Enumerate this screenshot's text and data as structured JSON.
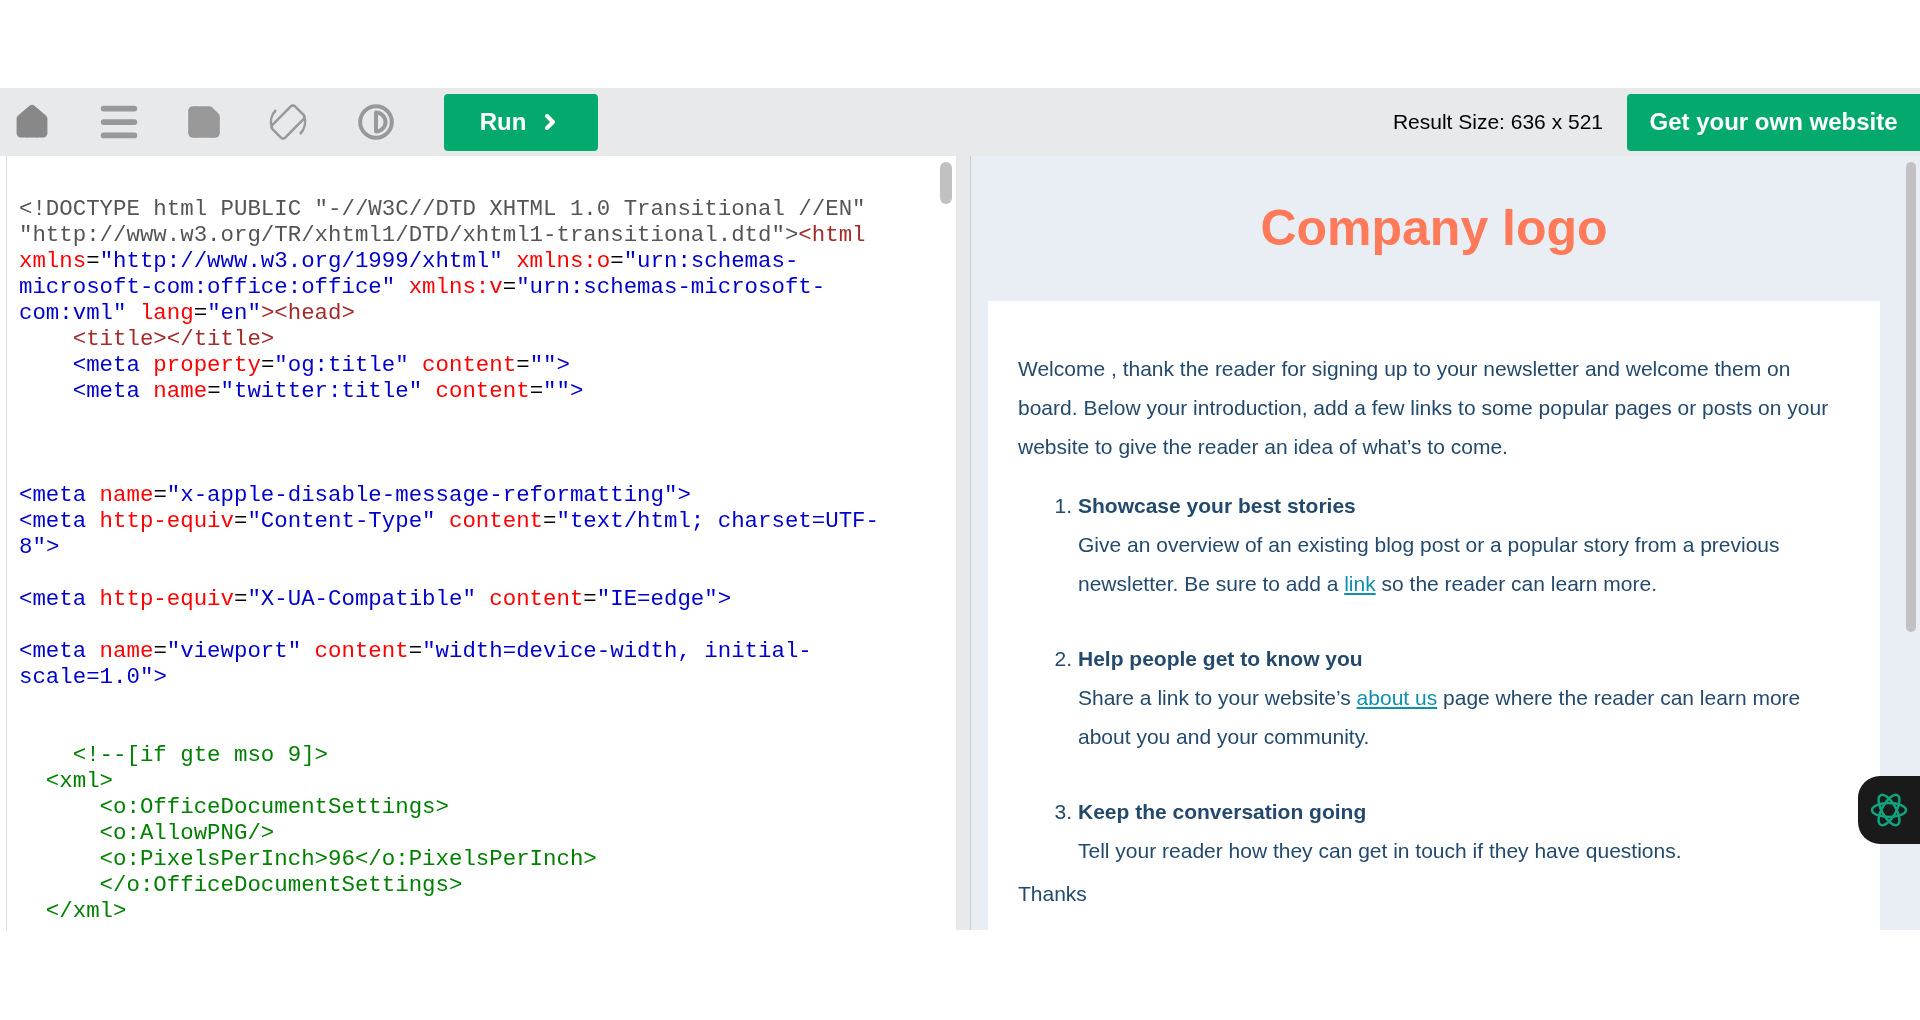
{
  "toolbar": {
    "run_button": "Run",
    "result_size": "Result Size: 636 x 521",
    "cta_button": "Get your own website"
  },
  "code": [
    {
      "kind": "code",
      "tokens": [
        {
          "kind": "doctype",
          "text": "<!DOCTYPE html PUBLIC \"-//W3C//DTD XHTML 1.0 Transitional //EN\""
        }
      ]
    },
    {
      "kind": "code",
      "tokens": [
        {
          "kind": "doctype",
          "text": "\"http://www.w3.org/TR/xhtml1/DTD/xhtml1-transitional.dtd\">"
        },
        {
          "kind": "tag",
          "text": "<html"
        }
      ]
    },
    {
      "kind": "code",
      "tokens": [
        {
          "kind": "attr",
          "text": "xmlns"
        },
        {
          "kind": "punct",
          "text": "="
        },
        {
          "kind": "value",
          "text": "\"http://www.w3.org/1999/xhtml\""
        },
        {
          "kind": "attr",
          "text": " xmlns:o"
        },
        {
          "kind": "punct",
          "text": "="
        },
        {
          "kind": "value",
          "text": "\"urn:schemas-"
        }
      ]
    },
    {
      "kind": "code",
      "tokens": [
        {
          "kind": "value",
          "text": "microsoft-com:office:office\""
        },
        {
          "kind": "attr",
          "text": " xmlns:v"
        },
        {
          "kind": "punct",
          "text": "="
        },
        {
          "kind": "value",
          "text": "\"urn:schemas-microsoft-"
        }
      ]
    },
    {
      "kind": "code",
      "tokens": [
        {
          "kind": "value",
          "text": "com:vml\""
        },
        {
          "kind": "attr",
          "text": " lang"
        },
        {
          "kind": "punct",
          "text": "="
        },
        {
          "kind": "value",
          "text": "\"en\""
        },
        {
          "kind": "tag",
          "text": "><head>"
        }
      ]
    },
    {
      "kind": "code",
      "tokens": [
        {
          "kind": "tag",
          "text": "    <title></title>"
        }
      ]
    },
    {
      "kind": "code",
      "tokens": [
        {
          "kind": "element",
          "text": "    <meta"
        },
        {
          "kind": "attr",
          "text": " property"
        },
        {
          "kind": "punct",
          "text": "="
        },
        {
          "kind": "value",
          "text": "\"og:title\""
        },
        {
          "kind": "attr",
          "text": " content"
        },
        {
          "kind": "punct",
          "text": "="
        },
        {
          "kind": "value",
          "text": "\"\""
        },
        {
          "kind": "element",
          "text": ">"
        }
      ]
    },
    {
      "kind": "code",
      "tokens": [
        {
          "kind": "element",
          "text": "    <meta"
        },
        {
          "kind": "attr",
          "text": " name"
        },
        {
          "kind": "punct",
          "text": "="
        },
        {
          "kind": "value",
          "text": "\"twitter:title\""
        },
        {
          "kind": "attr",
          "text": " content"
        },
        {
          "kind": "punct",
          "text": "="
        },
        {
          "kind": "value",
          "text": "\"\""
        },
        {
          "kind": "element",
          "text": ">"
        }
      ]
    },
    {
      "kind": "blank"
    },
    {
      "kind": "blank"
    },
    {
      "kind": "blank"
    },
    {
      "kind": "code",
      "tokens": [
        {
          "kind": "element",
          "text": "<meta"
        },
        {
          "kind": "attr",
          "text": " name"
        },
        {
          "kind": "punct",
          "text": "="
        },
        {
          "kind": "value",
          "text": "\"x-apple-disable-message-reformatting\""
        },
        {
          "kind": "element",
          "text": ">"
        }
      ]
    },
    {
      "kind": "code",
      "tokens": [
        {
          "kind": "element",
          "text": "<meta"
        },
        {
          "kind": "attr",
          "text": " http-equiv"
        },
        {
          "kind": "punct",
          "text": "="
        },
        {
          "kind": "value",
          "text": "\"Content-Type\""
        },
        {
          "kind": "attr",
          "text": " content"
        },
        {
          "kind": "punct",
          "text": "="
        },
        {
          "kind": "value",
          "text": "\"text/html; charset=UTF-"
        }
      ]
    },
    {
      "kind": "code",
      "tokens": [
        {
          "kind": "value",
          "text": "8\""
        },
        {
          "kind": "element",
          "text": ">"
        }
      ]
    },
    {
      "kind": "blank"
    },
    {
      "kind": "code",
      "tokens": [
        {
          "kind": "element",
          "text": "<meta"
        },
        {
          "kind": "attr",
          "text": " http-equiv"
        },
        {
          "kind": "punct",
          "text": "="
        },
        {
          "kind": "value",
          "text": "\"X-UA-Compatible\""
        },
        {
          "kind": "attr",
          "text": " content"
        },
        {
          "kind": "punct",
          "text": "="
        },
        {
          "kind": "value",
          "text": "\"IE=edge\""
        },
        {
          "kind": "element",
          "text": ">"
        }
      ]
    },
    {
      "kind": "blank"
    },
    {
      "kind": "code",
      "tokens": [
        {
          "kind": "element",
          "text": "<meta"
        },
        {
          "kind": "attr",
          "text": " name"
        },
        {
          "kind": "punct",
          "text": "="
        },
        {
          "kind": "value",
          "text": "\"viewport\""
        },
        {
          "kind": "attr",
          "text": " content"
        },
        {
          "kind": "punct",
          "text": "="
        },
        {
          "kind": "value",
          "text": "\"width=device-width, initial-"
        }
      ]
    },
    {
      "kind": "code",
      "tokens": [
        {
          "kind": "value",
          "text": "scale=1.0\""
        },
        {
          "kind": "element",
          "text": ">"
        }
      ]
    },
    {
      "kind": "blank"
    },
    {
      "kind": "blank"
    },
    {
      "kind": "code",
      "tokens": [
        {
          "kind": "comment",
          "text": "    <!--[if gte mso 9]>"
        }
      ]
    },
    {
      "kind": "code",
      "tokens": [
        {
          "kind": "comment",
          "text": "  <xml>"
        }
      ]
    },
    {
      "kind": "code",
      "tokens": [
        {
          "kind": "comment",
          "text": "      <o:OfficeDocumentSettings>"
        }
      ]
    },
    {
      "kind": "code",
      "tokens": [
        {
          "kind": "comment",
          "text": "      <o:AllowPNG/>"
        }
      ]
    },
    {
      "kind": "code",
      "tokens": [
        {
          "kind": "comment",
          "text": "      <o:PixelsPerInch>96</o:PixelsPerInch>"
        }
      ]
    },
    {
      "kind": "code",
      "tokens": [
        {
          "kind": "comment",
          "text": "      </o:OfficeDocumentSettings>"
        }
      ]
    },
    {
      "kind": "code",
      "tokens": [
        {
          "kind": "comment",
          "text": "  </xml>"
        }
      ]
    }
  ],
  "preview": {
    "logo": "Company logo",
    "intro": "Welcome , thank the reader for signing up to your newsletter and welcome them on board. Below your introduction, add a few links to some popular pages or posts on your website to give the reader an idea of what’s to come.",
    "items": [
      {
        "number": "1.",
        "title": "Showcase your best stories",
        "before": "Give an overview of an existing blog post or a popular story from a previous newsletter. Be sure to add a",
        "link": "link",
        "after": "so the reader can learn more."
      },
      {
        "number": "2.",
        "title": "Help people get to know you",
        "before": "Share a link to your website’s",
        "link": "about us",
        "after": "page where the reader can learn more about you and your community."
      },
      {
        "number": "3.",
        "title": "Keep the conversation going",
        "before": "Tell your reader how they can get in touch if they have questions."
      }
    ],
    "closing": "Thanks"
  }
}
